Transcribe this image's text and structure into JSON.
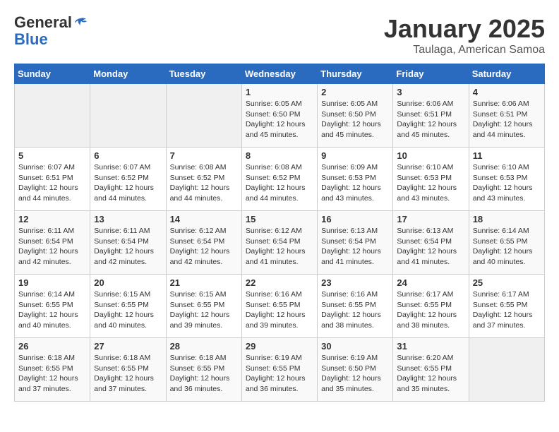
{
  "header": {
    "logo_line1": "General",
    "logo_line2": "Blue",
    "month": "January 2025",
    "location": "Taulaga, American Samoa"
  },
  "days_of_week": [
    "Sunday",
    "Monday",
    "Tuesday",
    "Wednesday",
    "Thursday",
    "Friday",
    "Saturday"
  ],
  "weeks": [
    [
      {
        "day": "",
        "info": ""
      },
      {
        "day": "",
        "info": ""
      },
      {
        "day": "",
        "info": ""
      },
      {
        "day": "1",
        "info": "Sunrise: 6:05 AM\nSunset: 6:50 PM\nDaylight: 12 hours\nand 45 minutes."
      },
      {
        "day": "2",
        "info": "Sunrise: 6:05 AM\nSunset: 6:50 PM\nDaylight: 12 hours\nand 45 minutes."
      },
      {
        "day": "3",
        "info": "Sunrise: 6:06 AM\nSunset: 6:51 PM\nDaylight: 12 hours\nand 45 minutes."
      },
      {
        "day": "4",
        "info": "Sunrise: 6:06 AM\nSunset: 6:51 PM\nDaylight: 12 hours\nand 44 minutes."
      }
    ],
    [
      {
        "day": "5",
        "info": "Sunrise: 6:07 AM\nSunset: 6:51 PM\nDaylight: 12 hours\nand 44 minutes."
      },
      {
        "day": "6",
        "info": "Sunrise: 6:07 AM\nSunset: 6:52 PM\nDaylight: 12 hours\nand 44 minutes."
      },
      {
        "day": "7",
        "info": "Sunrise: 6:08 AM\nSunset: 6:52 PM\nDaylight: 12 hours\nand 44 minutes."
      },
      {
        "day": "8",
        "info": "Sunrise: 6:08 AM\nSunset: 6:52 PM\nDaylight: 12 hours\nand 44 minutes."
      },
      {
        "day": "9",
        "info": "Sunrise: 6:09 AM\nSunset: 6:53 PM\nDaylight: 12 hours\nand 43 minutes."
      },
      {
        "day": "10",
        "info": "Sunrise: 6:10 AM\nSunset: 6:53 PM\nDaylight: 12 hours\nand 43 minutes."
      },
      {
        "day": "11",
        "info": "Sunrise: 6:10 AM\nSunset: 6:53 PM\nDaylight: 12 hours\nand 43 minutes."
      }
    ],
    [
      {
        "day": "12",
        "info": "Sunrise: 6:11 AM\nSunset: 6:54 PM\nDaylight: 12 hours\nand 42 minutes."
      },
      {
        "day": "13",
        "info": "Sunrise: 6:11 AM\nSunset: 6:54 PM\nDaylight: 12 hours\nand 42 minutes."
      },
      {
        "day": "14",
        "info": "Sunrise: 6:12 AM\nSunset: 6:54 PM\nDaylight: 12 hours\nand 42 minutes."
      },
      {
        "day": "15",
        "info": "Sunrise: 6:12 AM\nSunset: 6:54 PM\nDaylight: 12 hours\nand 41 minutes."
      },
      {
        "day": "16",
        "info": "Sunrise: 6:13 AM\nSunset: 6:54 PM\nDaylight: 12 hours\nand 41 minutes."
      },
      {
        "day": "17",
        "info": "Sunrise: 6:13 AM\nSunset: 6:54 PM\nDaylight: 12 hours\nand 41 minutes."
      },
      {
        "day": "18",
        "info": "Sunrise: 6:14 AM\nSunset: 6:55 PM\nDaylight: 12 hours\nand 40 minutes."
      }
    ],
    [
      {
        "day": "19",
        "info": "Sunrise: 6:14 AM\nSunset: 6:55 PM\nDaylight: 12 hours\nand 40 minutes."
      },
      {
        "day": "20",
        "info": "Sunrise: 6:15 AM\nSunset: 6:55 PM\nDaylight: 12 hours\nand 40 minutes."
      },
      {
        "day": "21",
        "info": "Sunrise: 6:15 AM\nSunset: 6:55 PM\nDaylight: 12 hours\nand 39 minutes."
      },
      {
        "day": "22",
        "info": "Sunrise: 6:16 AM\nSunset: 6:55 PM\nDaylight: 12 hours\nand 39 minutes."
      },
      {
        "day": "23",
        "info": "Sunrise: 6:16 AM\nSunset: 6:55 PM\nDaylight: 12 hours\nand 38 minutes."
      },
      {
        "day": "24",
        "info": "Sunrise: 6:17 AM\nSunset: 6:55 PM\nDaylight: 12 hours\nand 38 minutes."
      },
      {
        "day": "25",
        "info": "Sunrise: 6:17 AM\nSunset: 6:55 PM\nDaylight: 12 hours\nand 37 minutes."
      }
    ],
    [
      {
        "day": "26",
        "info": "Sunrise: 6:18 AM\nSunset: 6:55 PM\nDaylight: 12 hours\nand 37 minutes."
      },
      {
        "day": "27",
        "info": "Sunrise: 6:18 AM\nSunset: 6:55 PM\nDaylight: 12 hours\nand 37 minutes."
      },
      {
        "day": "28",
        "info": "Sunrise: 6:18 AM\nSunset: 6:55 PM\nDaylight: 12 hours\nand 36 minutes."
      },
      {
        "day": "29",
        "info": "Sunrise: 6:19 AM\nSunset: 6:55 PM\nDaylight: 12 hours\nand 36 minutes."
      },
      {
        "day": "30",
        "info": "Sunrise: 6:19 AM\nSunset: 6:50 PM\nDaylight: 12 hours\nand 35 minutes."
      },
      {
        "day": "31",
        "info": "Sunrise: 6:20 AM\nSunset: 6:55 PM\nDaylight: 12 hours\nand 35 minutes."
      },
      {
        "day": "",
        "info": ""
      }
    ]
  ]
}
